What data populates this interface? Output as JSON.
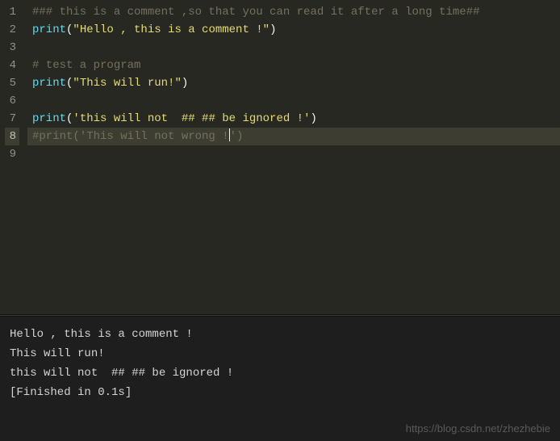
{
  "editor": {
    "active_line": 8,
    "lines": [
      {
        "num": "1",
        "tokens": [
          {
            "cls": "tok-comment",
            "text": "### this is a comment ,so that you can read it after a long time##"
          }
        ]
      },
      {
        "num": "2",
        "tokens": [
          {
            "cls": "tok-func",
            "text": "print"
          },
          {
            "cls": "tok-punc",
            "text": "("
          },
          {
            "cls": "tok-string",
            "text": "\"Hello , this is a comment !\""
          },
          {
            "cls": "tok-punc",
            "text": ")"
          }
        ]
      },
      {
        "num": "3",
        "tokens": []
      },
      {
        "num": "4",
        "tokens": [
          {
            "cls": "tok-comment",
            "text": "# test a program"
          }
        ]
      },
      {
        "num": "5",
        "tokens": [
          {
            "cls": "tok-func",
            "text": "print"
          },
          {
            "cls": "tok-punc",
            "text": "("
          },
          {
            "cls": "tok-string",
            "text": "\"This will run!\""
          },
          {
            "cls": "tok-punc",
            "text": ")"
          }
        ]
      },
      {
        "num": "6",
        "tokens": []
      },
      {
        "num": "7",
        "tokens": [
          {
            "cls": "tok-func",
            "text": "print"
          },
          {
            "cls": "tok-punc",
            "text": "("
          },
          {
            "cls": "tok-string",
            "text": "'this will not  ## ## be ignored !'"
          },
          {
            "cls": "tok-punc",
            "text": ")"
          }
        ]
      },
      {
        "num": "8",
        "tokens": [
          {
            "cls": "tok-comment",
            "text": "#print('This will not wrong !"
          },
          {
            "cls": "cursor",
            "text": ""
          },
          {
            "cls": "tok-comment",
            "text": "')"
          }
        ]
      },
      {
        "num": "9",
        "tokens": []
      }
    ]
  },
  "output": {
    "lines": [
      "Hello , this is a comment !",
      "This will run!",
      "this will not  ## ## be ignored !",
      "[Finished in 0.1s]"
    ]
  },
  "watermark": "https://blog.csdn.net/zhezhebie"
}
